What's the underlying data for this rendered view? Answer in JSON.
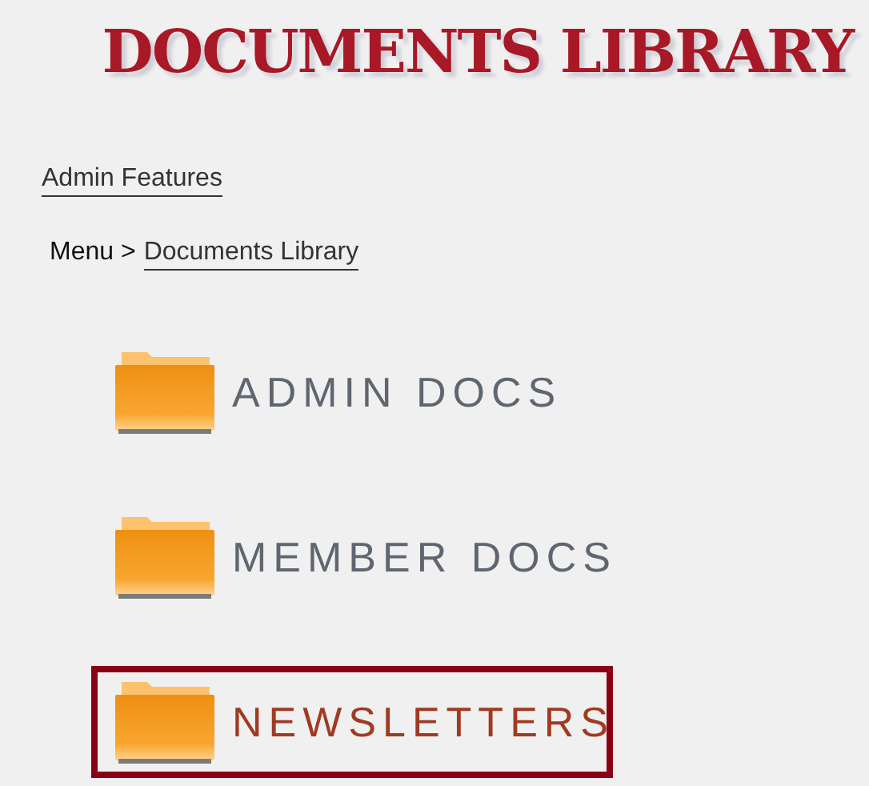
{
  "title": "DOCUMENTS LIBRARY",
  "admin_link": "Admin Features",
  "breadcrumb": {
    "prefix": "Menu >",
    "link": "Documents Library"
  },
  "folders": [
    {
      "label": "ADMIN DOCS",
      "selected": false
    },
    {
      "label": "MEMBER DOCS",
      "selected": false
    },
    {
      "label": "NEWSLETTERS",
      "selected": true
    }
  ]
}
